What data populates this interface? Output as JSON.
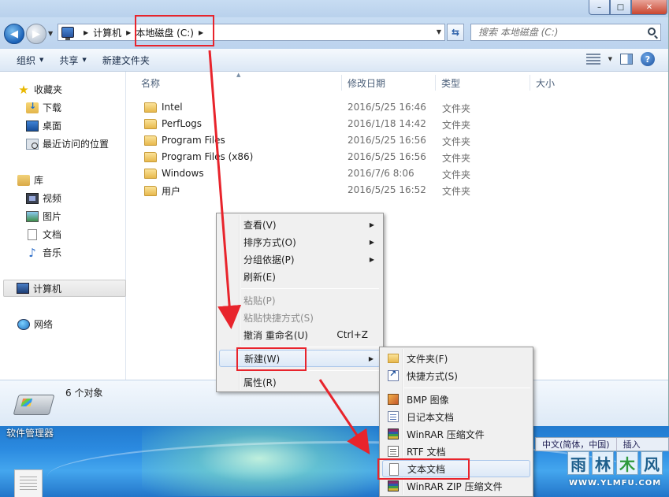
{
  "window": {
    "controls": {
      "minimize": "–",
      "maximize": "□",
      "close": "✕"
    }
  },
  "address": {
    "crumbs": [
      "计算机",
      "本地磁盘 (C:)"
    ],
    "search_placeholder": "搜索 本地磁盘 (C:)"
  },
  "toolbar": {
    "organize": "组织",
    "share": "共享",
    "new_folder": "新建文件夹"
  },
  "nav": {
    "favorites": "收藏夹",
    "downloads": "下载",
    "desktop": "桌面",
    "recent": "最近访问的位置",
    "libraries": "库",
    "videos": "视频",
    "pictures": "图片",
    "documents": "文档",
    "music": "音乐",
    "computer": "计算机",
    "network": "网络"
  },
  "columns": {
    "name": "名称",
    "modified": "修改日期",
    "type": "类型",
    "size": "大小"
  },
  "files": [
    {
      "name": "Intel",
      "date": "2016/5/25 16:46",
      "type": "文件夹"
    },
    {
      "name": "PerfLogs",
      "date": "2016/1/18 14:42",
      "type": "文件夹"
    },
    {
      "name": "Program Files",
      "date": "2016/5/25 16:56",
      "type": "文件夹"
    },
    {
      "name": "Program Files (x86)",
      "date": "2016/5/25 16:56",
      "type": "文件夹"
    },
    {
      "name": "Windows",
      "date": "2016/7/6 8:06",
      "type": "文件夹"
    },
    {
      "name": "用户",
      "date": "2016/5/25 16:52",
      "type": "文件夹"
    }
  ],
  "details": {
    "count": "6 个对象"
  },
  "context_menu": {
    "view": "查看(V)",
    "sort": "排序方式(O)",
    "group": "分组依据(P)",
    "refresh": "刷新(E)",
    "paste": "粘贴(P)",
    "paste_shortcut": "粘贴快捷方式(S)",
    "undo": "撤消 重命名(U)",
    "undo_shortcut": "Ctrl+Z",
    "new": "新建(W)",
    "properties": "属性(R)"
  },
  "new_submenu": {
    "folder": "文件夹(F)",
    "shortcut": "快捷方式(S)",
    "bmp": "BMP 图像",
    "journal": "日记本文档",
    "winrar": "WinRAR 压缩文件",
    "rtf": "RTF 文档",
    "text": "文本文档",
    "winrar_zip": "WinRAR ZIP 压缩文件"
  },
  "desktop": {
    "label": "软件管理器",
    "ime": [
      "中文(简体，中国)",
      "插入"
    ]
  },
  "watermark": {
    "chars": [
      "雨",
      "林",
      "木",
      "风"
    ],
    "url": "WWW.YLMFU.COM"
  },
  "colors": {
    "annotation": "#e8242c",
    "accent": "#1b62b8"
  }
}
